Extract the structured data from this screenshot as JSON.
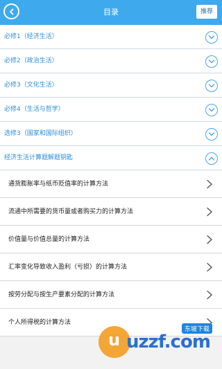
{
  "header": {
    "title": "目录",
    "recommend_label": "推荐"
  },
  "chapters": [
    {
      "label": "必修1（经济生活）",
      "state": "collapsed"
    },
    {
      "label": "必修2（政治生活）",
      "state": "collapsed"
    },
    {
      "label": "必修3（文化生活）",
      "state": "collapsed"
    },
    {
      "label": "必修4（生活与哲学）",
      "state": "collapsed"
    },
    {
      "label": "选修3（国家和国际组织）",
      "state": "collapsed"
    },
    {
      "label": "经济生活计算题解题钥匙",
      "state": "expanded"
    }
  ],
  "sub_items": [
    {
      "label": "通货膨胀率与纸币贬值率的计算方法"
    },
    {
      "label": "流通中所需要的货币量或者购买力的计算方法"
    },
    {
      "label": "价值量与价值总量的计算方法"
    },
    {
      "label": "汇率变化导致收入盈利（亏损）的计算方法"
    },
    {
      "label": "按劳分配与按生产要素分配的计算方法"
    },
    {
      "label": "个人所得税的计算方法"
    }
  ],
  "watermark": {
    "brand": "uzzf.com",
    "badge": "东坡下载"
  },
  "colors": {
    "header_bg": "#3fa9ee",
    "chapter_text": "#2b8edb",
    "item_text": "#222222"
  }
}
